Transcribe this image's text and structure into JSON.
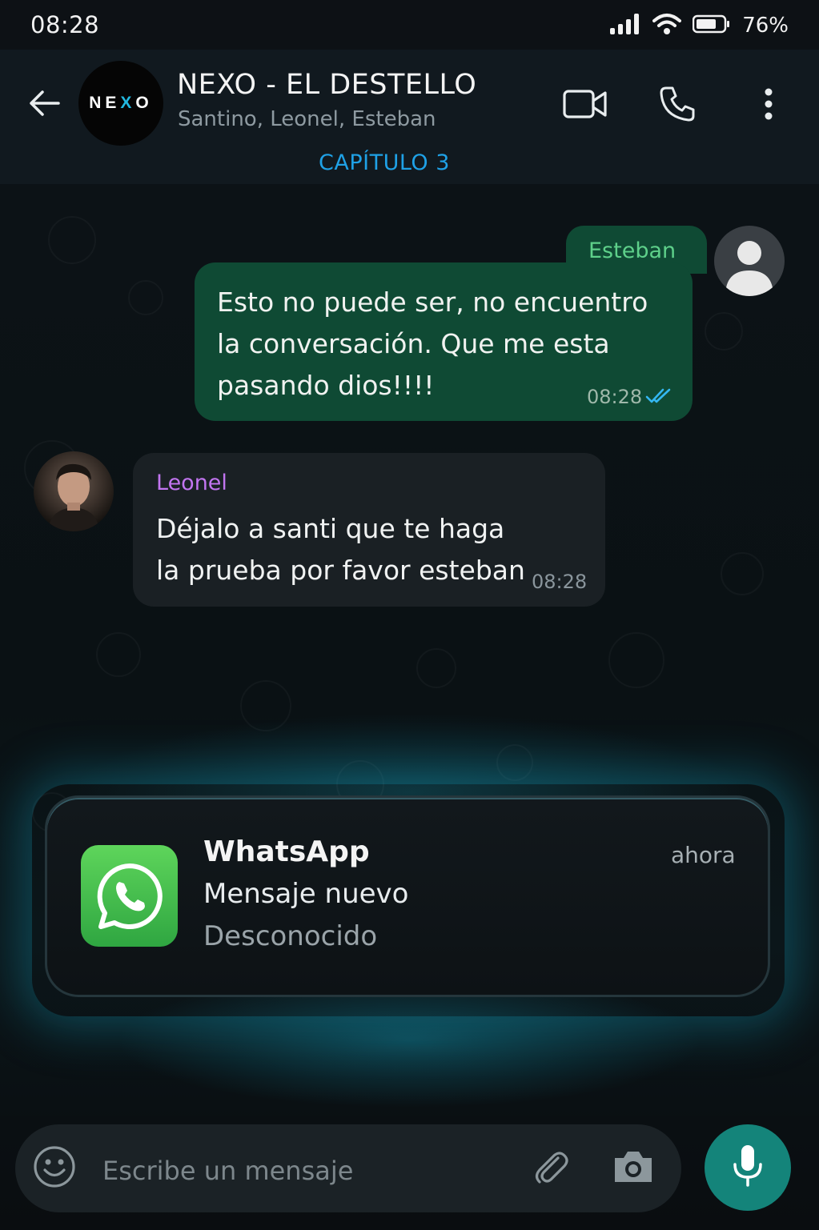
{
  "status_bar": {
    "time": "08:28",
    "battery": "76%"
  },
  "header": {
    "logo_left": "NE",
    "logo_x": "X",
    "logo_right": "O",
    "title": "NEXO - EL DESTELLO",
    "members": "Santino, Leonel, Esteban",
    "chapter": "CAPÍTULO 3"
  },
  "messages": [
    {
      "sender": "Esteban",
      "text": "Esto no puede ser, no encuentro la conversación. Que me esta pasando dios!!!!",
      "time": "08:28",
      "direction": "outgoing",
      "read": true
    },
    {
      "sender": "Leonel",
      "text": "Déjalo a santi que te haga la prueba por favor esteban",
      "time": "08:28",
      "direction": "incoming"
    }
  ],
  "notification": {
    "app": "WhatsApp",
    "time": "ahora",
    "title": "Mensaje nuevo",
    "body": "Desconocido"
  },
  "composer": {
    "placeholder": "Escribe un mensaje"
  },
  "colors": {
    "outgoing_bubble": "#0f4a34",
    "incoming_bubble": "#1a2024",
    "accent_blue": "#1fa1e6",
    "mic_button": "#14847a",
    "whatsapp_green": "#3cb64a"
  }
}
